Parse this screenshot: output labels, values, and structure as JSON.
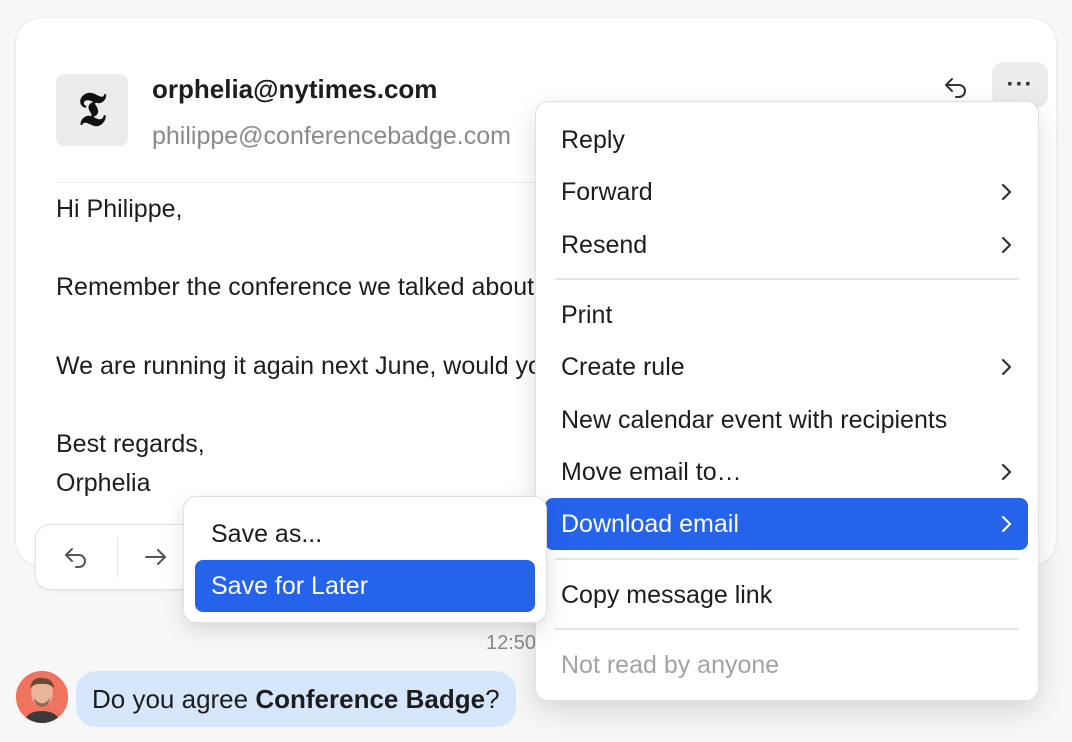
{
  "email": {
    "logo_glyph": "𝕿",
    "from": "orphelia@nytimes.com",
    "to": "philippe@conferencebadge.com",
    "greeting": "Hi Philippe,",
    "line1": "Remember the conference we talked about",
    "line2": "We are running it again next June, would you",
    "signoff": "Best regards,",
    "signature": "Orphelia"
  },
  "header_actions": {
    "more_label": "···"
  },
  "timestamp": "12:50",
  "chat": {
    "prefix": "Do you agree ",
    "bold": "Conference Badge",
    "suffix": "?"
  },
  "context_menu": {
    "items": [
      {
        "label": "Reply"
      },
      {
        "label": "Forward"
      },
      {
        "label": "Resend"
      },
      {
        "label": "Print"
      },
      {
        "label": "Create rule"
      },
      {
        "label": "New calendar event with recipients"
      },
      {
        "label": "Move email to…"
      },
      {
        "label": "Download email"
      },
      {
        "label": "Copy message link"
      },
      {
        "label": "Not read by anyone"
      }
    ]
  },
  "download_submenu": {
    "items": [
      {
        "label": "Save as..."
      },
      {
        "label": "Save for Later"
      }
    ]
  },
  "colors": {
    "accent": "#2563eb",
    "chat_bubble": "#d6e6fb",
    "avatar_bg": "#f0735f"
  },
  "icons": {
    "header_reply": "reply-arrow-icon",
    "more": "more-dots-icon",
    "bar_reply": "reply-arrow-icon",
    "bar_forward": "forward-arrow-icon",
    "chevron": "chevron-right-icon"
  }
}
